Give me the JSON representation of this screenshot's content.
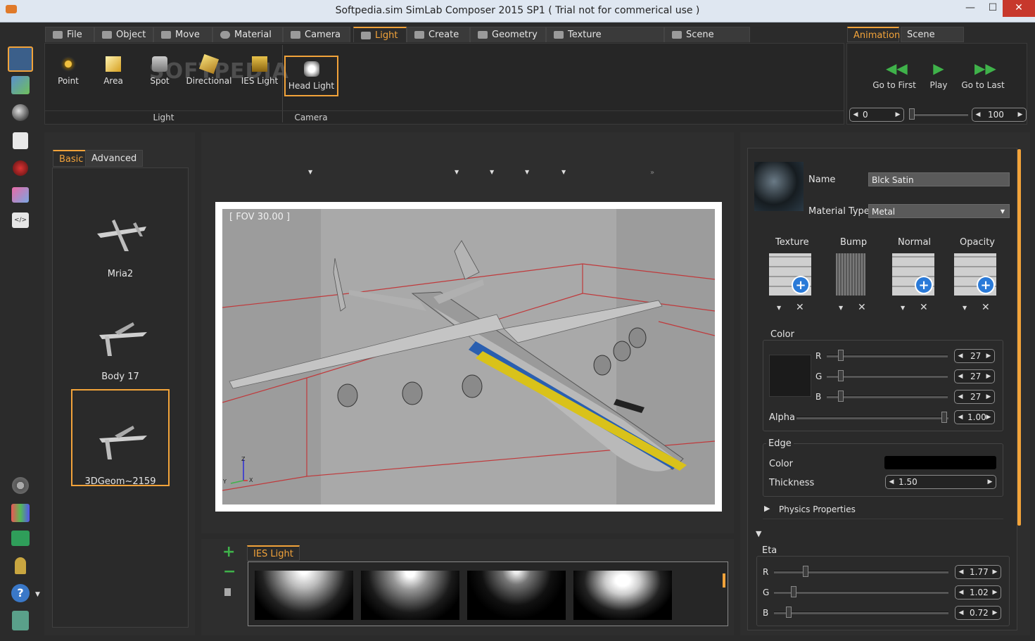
{
  "window": {
    "title": "Softpedia.sim SimLab Composer 2015 SP1 ( Trial not for commerical use )"
  },
  "menu_tabs": [
    "File",
    "Object",
    "Move",
    "Material",
    "Camera",
    "Light",
    "Create",
    "Geometry",
    "Texture Coordinates",
    "Scene States"
  ],
  "menu_active": "Light",
  "right_tabs": [
    "Animation",
    "Scene States"
  ],
  "ribbon": {
    "light_buttons": [
      "Point",
      "Area",
      "Spot",
      "Directional",
      "IES Light"
    ],
    "camera_buttons": [
      "Head Light"
    ],
    "group_light": "Light",
    "group_camera": "Camera",
    "watermark": "SOFTPEDIA"
  },
  "animation": {
    "buttons": [
      "Go to First",
      "Play",
      "Go to Last"
    ],
    "start": "0",
    "end": "100"
  },
  "object_panel": {
    "tabs": [
      "Basic",
      "Advanced"
    ],
    "items": [
      "Mria2",
      "Body 17",
      "3DGeom~2159"
    ],
    "selected": "3DGeom~2159"
  },
  "viewport": {
    "fov": "[ FOV 30.00 ]",
    "axes": [
      "Z",
      "Y",
      "X"
    ]
  },
  "library": {
    "tab": "IES Light",
    "add": "+",
    "remove": "−"
  },
  "material": {
    "name_label": "Name",
    "name": "Blck Satin",
    "type_label": "Material Type",
    "type": "Metal",
    "slots": [
      "Texture",
      "Bump",
      "Normal",
      "Opacity"
    ],
    "color_label": "Color",
    "color": {
      "r": "27",
      "g": "27",
      "b": "27",
      "alpha": "1.00",
      "r_label": "R",
      "g_label": "G",
      "b_label": "B",
      "alpha_label": "Alpha",
      "swatch": "#1b1b1b"
    },
    "edge_label": "Edge",
    "edge_color_label": "Color",
    "thickness_label": "Thickness",
    "thickness": "1.50",
    "physics_label": "Physics Properties",
    "eta_label": "Eta",
    "eta": {
      "r": "1.77",
      "g": "1.02",
      "b": "0.72",
      "r_label": "R",
      "g_label": "G",
      "b_label": "B"
    }
  },
  "colors": {
    "accent": "#f2a33a",
    "bg": "#2b2b2b"
  }
}
